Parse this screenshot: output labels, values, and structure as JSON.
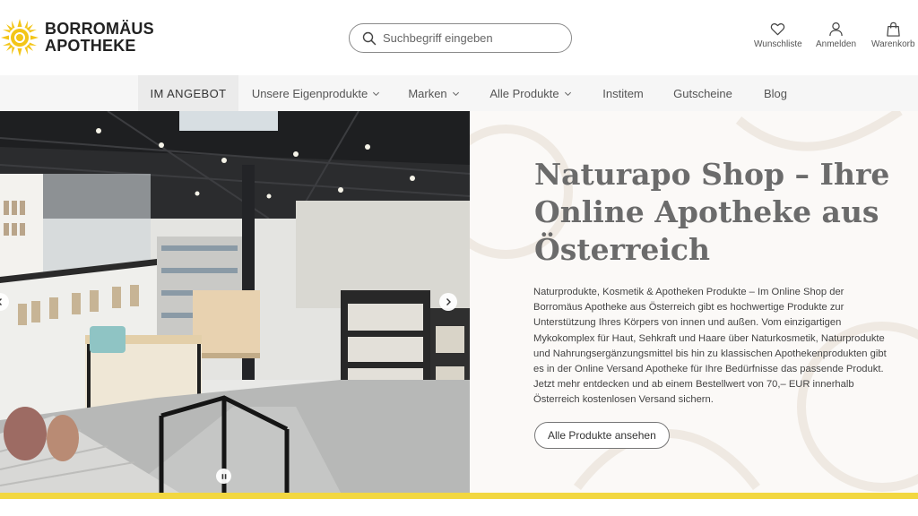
{
  "brand": {
    "line1": "BORROMÄUS",
    "line2": "APOTHEKE",
    "logo_color": "#f3c517"
  },
  "search": {
    "placeholder": "Suchbegriff eingeben",
    "icon": "search-icon"
  },
  "header_actions": [
    {
      "label": "Wunschliste",
      "icon": "heart-icon"
    },
    {
      "label": "Anmelden",
      "icon": "user-icon"
    },
    {
      "label": "Warenkorb",
      "icon": "shopping-bag-icon"
    }
  ],
  "nav": {
    "items": [
      {
        "label": "IM ANGEBOT",
        "active": true,
        "dropdown": false
      },
      {
        "label": "Unsere Eigenprodukte",
        "active": false,
        "dropdown": true
      },
      {
        "label": "Marken",
        "active": false,
        "dropdown": true
      },
      {
        "label": "Alle Produkte",
        "active": false,
        "dropdown": true
      },
      {
        "label": "Institem",
        "active": false,
        "dropdown": false
      },
      {
        "label": "Gutscheine",
        "active": false,
        "dropdown": false
      },
      {
        "label": "Blog",
        "active": false,
        "dropdown": false
      }
    ]
  },
  "hero": {
    "title": "Naturapo Shop – Ihre Online Apotheke aus Österreich",
    "text": "Naturprodukte, Kosmetik & Apotheken Produkte – Im Online Shop der Borromäus Apotheke aus Österreich gibt es hochwertige Produkte zur Unterstützung Ihres Körpers von innen und außen. Vom einzigartigen Mykokomplex für Haut, Sehkraft und Haare über Naturkosmetik, Naturprodukte und Nahrungsergänzungsmittel bis hin zu klassischen Apothekenprodukten gibt es in der Online Versand Apotheke für Ihre Bedürfnisse das passende Produkt. Jetzt mehr entdecken und ab einem Bestellwert von 70,– EUR innerhalb Österreich kostenlosen Versand sichern.",
    "button_label": "Alle Produkte ansehen",
    "image_alt": "store-interior-photo"
  },
  "carousel": {
    "prev_icon": "chevron-left-icon",
    "next_icon": "chevron-right-icon",
    "pause_icon": "pause-icon"
  },
  "colors": {
    "accent_yellow": "#f2d740",
    "title_gray": "#6b6b6b",
    "nav_bg": "#f6f6f6"
  }
}
